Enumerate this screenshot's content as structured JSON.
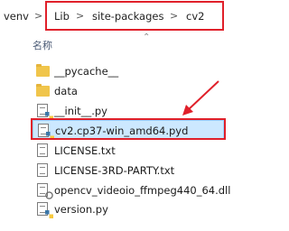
{
  "breadcrumb": {
    "items": [
      "venv",
      "Lib",
      "site-packages",
      "cv2"
    ],
    "separator": ">"
  },
  "columns": {
    "name": "名称"
  },
  "files": [
    {
      "name": "__pycache__",
      "icon": "folder-icon"
    },
    {
      "name": "data",
      "icon": "folder-icon"
    },
    {
      "name": "__init__.py",
      "icon": "python-file-icon"
    },
    {
      "name": "cv2.cp37-win_amd64.pyd",
      "icon": "python-pyd-icon",
      "selected": true
    },
    {
      "name": "LICENSE.txt",
      "icon": "text-file-icon"
    },
    {
      "name": "LICENSE-3RD-PARTY.txt",
      "icon": "text-file-icon"
    },
    {
      "name": "opencv_videoio_ffmpeg440_64.dll",
      "icon": "dll-file-icon"
    },
    {
      "name": "version.py",
      "icon": "python-file-icon"
    }
  ],
  "colors": {
    "annotation": "#e0202a",
    "selection": "#cce8ff",
    "folder": "#f0c54b"
  }
}
